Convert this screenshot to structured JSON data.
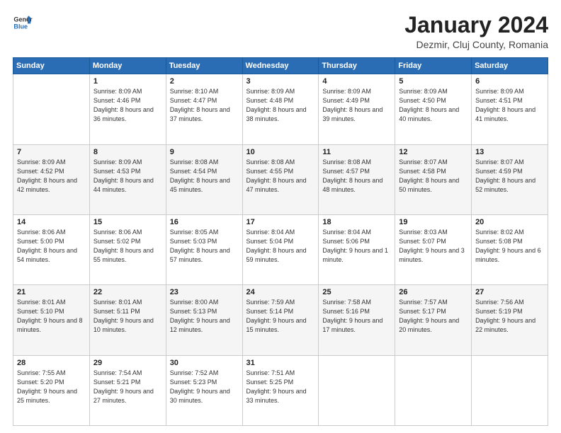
{
  "header": {
    "logo_general": "General",
    "logo_blue": "Blue",
    "month": "January 2024",
    "location": "Dezmir, Cluj County, Romania"
  },
  "weekdays": [
    "Sunday",
    "Monday",
    "Tuesday",
    "Wednesday",
    "Thursday",
    "Friday",
    "Saturday"
  ],
  "weeks": [
    [
      {
        "day": "",
        "sunrise": "",
        "sunset": "",
        "daylight": ""
      },
      {
        "day": "1",
        "sunrise": "Sunrise: 8:09 AM",
        "sunset": "Sunset: 4:46 PM",
        "daylight": "Daylight: 8 hours and 36 minutes."
      },
      {
        "day": "2",
        "sunrise": "Sunrise: 8:10 AM",
        "sunset": "Sunset: 4:47 PM",
        "daylight": "Daylight: 8 hours and 37 minutes."
      },
      {
        "day": "3",
        "sunrise": "Sunrise: 8:09 AM",
        "sunset": "Sunset: 4:48 PM",
        "daylight": "Daylight: 8 hours and 38 minutes."
      },
      {
        "day": "4",
        "sunrise": "Sunrise: 8:09 AM",
        "sunset": "Sunset: 4:49 PM",
        "daylight": "Daylight: 8 hours and 39 minutes."
      },
      {
        "day": "5",
        "sunrise": "Sunrise: 8:09 AM",
        "sunset": "Sunset: 4:50 PM",
        "daylight": "Daylight: 8 hours and 40 minutes."
      },
      {
        "day": "6",
        "sunrise": "Sunrise: 8:09 AM",
        "sunset": "Sunset: 4:51 PM",
        "daylight": "Daylight: 8 hours and 41 minutes."
      }
    ],
    [
      {
        "day": "7",
        "sunrise": "Sunrise: 8:09 AM",
        "sunset": "Sunset: 4:52 PM",
        "daylight": "Daylight: 8 hours and 42 minutes."
      },
      {
        "day": "8",
        "sunrise": "Sunrise: 8:09 AM",
        "sunset": "Sunset: 4:53 PM",
        "daylight": "Daylight: 8 hours and 44 minutes."
      },
      {
        "day": "9",
        "sunrise": "Sunrise: 8:08 AM",
        "sunset": "Sunset: 4:54 PM",
        "daylight": "Daylight: 8 hours and 45 minutes."
      },
      {
        "day": "10",
        "sunrise": "Sunrise: 8:08 AM",
        "sunset": "Sunset: 4:55 PM",
        "daylight": "Daylight: 8 hours and 47 minutes."
      },
      {
        "day": "11",
        "sunrise": "Sunrise: 8:08 AM",
        "sunset": "Sunset: 4:57 PM",
        "daylight": "Daylight: 8 hours and 48 minutes."
      },
      {
        "day": "12",
        "sunrise": "Sunrise: 8:07 AM",
        "sunset": "Sunset: 4:58 PM",
        "daylight": "Daylight: 8 hours and 50 minutes."
      },
      {
        "day": "13",
        "sunrise": "Sunrise: 8:07 AM",
        "sunset": "Sunset: 4:59 PM",
        "daylight": "Daylight: 8 hours and 52 minutes."
      }
    ],
    [
      {
        "day": "14",
        "sunrise": "Sunrise: 8:06 AM",
        "sunset": "Sunset: 5:00 PM",
        "daylight": "Daylight: 8 hours and 54 minutes."
      },
      {
        "day": "15",
        "sunrise": "Sunrise: 8:06 AM",
        "sunset": "Sunset: 5:02 PM",
        "daylight": "Daylight: 8 hours and 55 minutes."
      },
      {
        "day": "16",
        "sunrise": "Sunrise: 8:05 AM",
        "sunset": "Sunset: 5:03 PM",
        "daylight": "Daylight: 8 hours and 57 minutes."
      },
      {
        "day": "17",
        "sunrise": "Sunrise: 8:04 AM",
        "sunset": "Sunset: 5:04 PM",
        "daylight": "Daylight: 8 hours and 59 minutes."
      },
      {
        "day": "18",
        "sunrise": "Sunrise: 8:04 AM",
        "sunset": "Sunset: 5:06 PM",
        "daylight": "Daylight: 9 hours and 1 minute."
      },
      {
        "day": "19",
        "sunrise": "Sunrise: 8:03 AM",
        "sunset": "Sunset: 5:07 PM",
        "daylight": "Daylight: 9 hours and 3 minutes."
      },
      {
        "day": "20",
        "sunrise": "Sunrise: 8:02 AM",
        "sunset": "Sunset: 5:08 PM",
        "daylight": "Daylight: 9 hours and 6 minutes."
      }
    ],
    [
      {
        "day": "21",
        "sunrise": "Sunrise: 8:01 AM",
        "sunset": "Sunset: 5:10 PM",
        "daylight": "Daylight: 9 hours and 8 minutes."
      },
      {
        "day": "22",
        "sunrise": "Sunrise: 8:01 AM",
        "sunset": "Sunset: 5:11 PM",
        "daylight": "Daylight: 9 hours and 10 minutes."
      },
      {
        "day": "23",
        "sunrise": "Sunrise: 8:00 AM",
        "sunset": "Sunset: 5:13 PM",
        "daylight": "Daylight: 9 hours and 12 minutes."
      },
      {
        "day": "24",
        "sunrise": "Sunrise: 7:59 AM",
        "sunset": "Sunset: 5:14 PM",
        "daylight": "Daylight: 9 hours and 15 minutes."
      },
      {
        "day": "25",
        "sunrise": "Sunrise: 7:58 AM",
        "sunset": "Sunset: 5:16 PM",
        "daylight": "Daylight: 9 hours and 17 minutes."
      },
      {
        "day": "26",
        "sunrise": "Sunrise: 7:57 AM",
        "sunset": "Sunset: 5:17 PM",
        "daylight": "Daylight: 9 hours and 20 minutes."
      },
      {
        "day": "27",
        "sunrise": "Sunrise: 7:56 AM",
        "sunset": "Sunset: 5:19 PM",
        "daylight": "Daylight: 9 hours and 22 minutes."
      }
    ],
    [
      {
        "day": "28",
        "sunrise": "Sunrise: 7:55 AM",
        "sunset": "Sunset: 5:20 PM",
        "daylight": "Daylight: 9 hours and 25 minutes."
      },
      {
        "day": "29",
        "sunrise": "Sunrise: 7:54 AM",
        "sunset": "Sunset: 5:21 PM",
        "daylight": "Daylight: 9 hours and 27 minutes."
      },
      {
        "day": "30",
        "sunrise": "Sunrise: 7:52 AM",
        "sunset": "Sunset: 5:23 PM",
        "daylight": "Daylight: 9 hours and 30 minutes."
      },
      {
        "day": "31",
        "sunrise": "Sunrise: 7:51 AM",
        "sunset": "Sunset: 5:25 PM",
        "daylight": "Daylight: 9 hours and 33 minutes."
      },
      {
        "day": "",
        "sunrise": "",
        "sunset": "",
        "daylight": ""
      },
      {
        "day": "",
        "sunrise": "",
        "sunset": "",
        "daylight": ""
      },
      {
        "day": "",
        "sunrise": "",
        "sunset": "",
        "daylight": ""
      }
    ]
  ]
}
